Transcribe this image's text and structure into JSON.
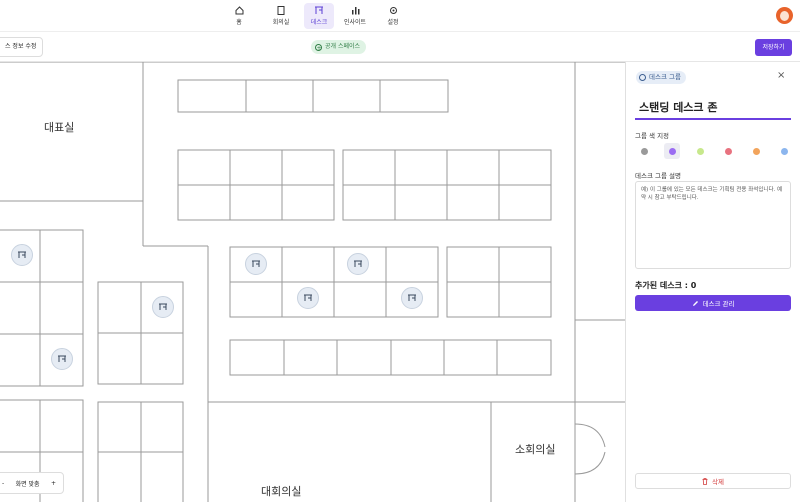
{
  "nav": {
    "items": [
      {
        "label": "홈",
        "icon": "home-icon"
      },
      {
        "label": "회의실",
        "icon": "document-icon"
      },
      {
        "label": "데스크",
        "icon": "desk-icon"
      },
      {
        "label": "인사이트",
        "icon": "bar-chart-icon"
      },
      {
        "label": "설정",
        "icon": "gear-icon"
      }
    ],
    "active_index": 2
  },
  "toolbar": {
    "edit_label": "스 정보 수정",
    "public_label": "공개 스페이스",
    "save_label": "저장하기"
  },
  "floorplan": {
    "rooms": [
      "대표실",
      "대회의실",
      "소회의실"
    ],
    "desk_icon": "desk-icon"
  },
  "zoom": {
    "minus": "-",
    "fit_label": "화면 맞춤",
    "plus": "+"
  },
  "panel": {
    "chip_label": "데스크 그룹",
    "close": "×",
    "title": "스탠딩 데스크 존",
    "color_label": "그룹 색 지정",
    "colors": [
      "#9a9a9a",
      "#9b6cf2",
      "#c7e88c",
      "#e8727f",
      "#f2a45c",
      "#8cb6ee"
    ],
    "selected_color_index": 1,
    "desc_label": "데스크 그룹 설명",
    "desc_placeholder": "예) 이 그룹에 있는 모든 데스크는 기획팀 전용 좌석입니다. 예약 시 참고 부탁드립니다.",
    "added_label": "추가된 데스크 : 0",
    "manage_label": "데스크 관리",
    "delete_label": "삭제"
  },
  "colors": {
    "accent": "#6a3fe0",
    "public_green": "#2f7d45"
  }
}
